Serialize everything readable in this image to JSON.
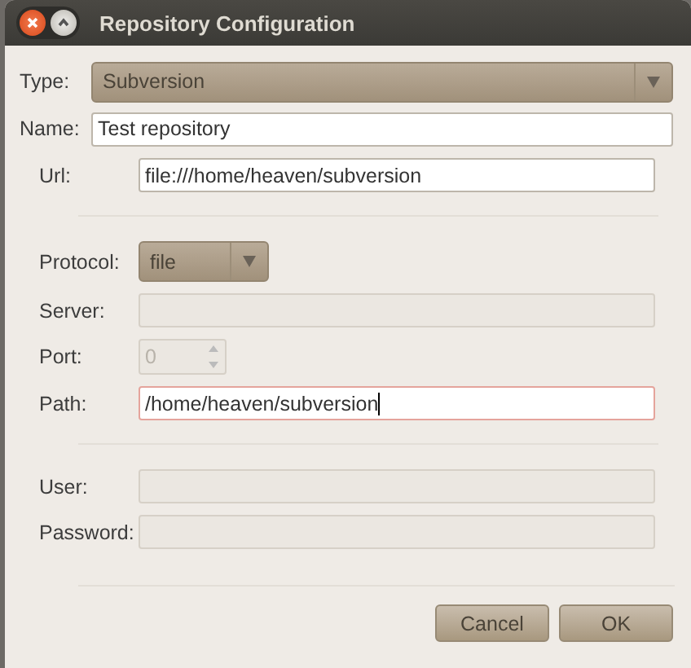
{
  "window": {
    "title": "Repository Configuration"
  },
  "type": {
    "label": "Type:",
    "value": "Subversion"
  },
  "name": {
    "label": "Name:",
    "value": "Test repository"
  },
  "url": {
    "label": "Url:",
    "value": "file:///home/heaven/subversion"
  },
  "protocol": {
    "label": "Protocol:",
    "value": "file"
  },
  "connection_fields": [
    {
      "label": "Server:",
      "kind": "text",
      "disabled": true,
      "focused": false
    },
    {
      "label": "Port:",
      "kind": "spin",
      "value": "0",
      "disabled": true,
      "focused": false
    },
    {
      "label": "Path:",
      "kind": "text",
      "value": "/home/heaven/subversion",
      "disabled": false,
      "focused": true
    }
  ],
  "credentials": [
    {
      "label": "User:",
      "disabled": true
    },
    {
      "label": "Password:",
      "disabled": true
    }
  ],
  "buttons": [
    "Cancel",
    "OK"
  ]
}
